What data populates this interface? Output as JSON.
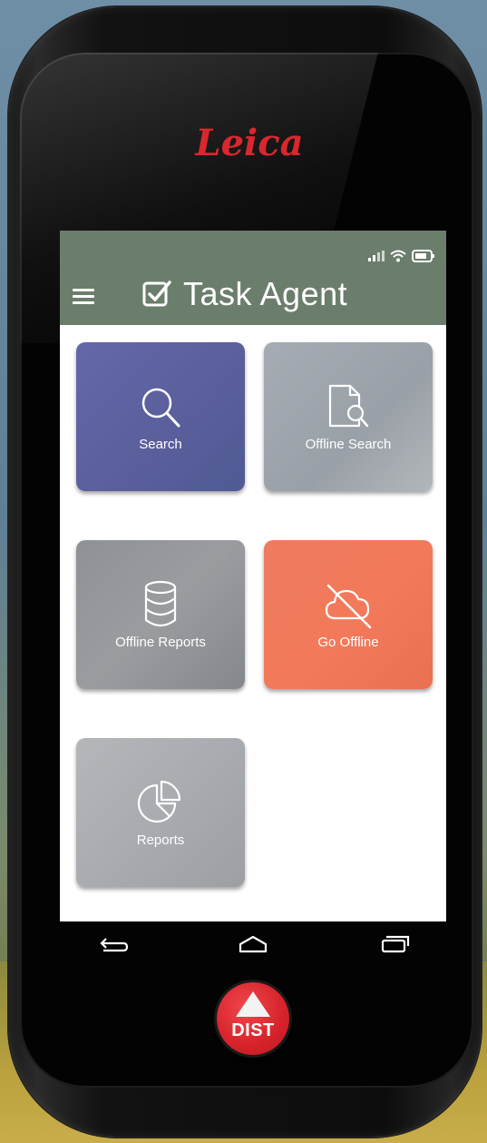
{
  "brand": {
    "logo_text": "Leica",
    "logo_color": "#d9272e"
  },
  "app": {
    "title": "Task Agent",
    "appbar_color": "#6b7e6c"
  },
  "tiles": [
    {
      "label": "Search",
      "icon": "search-icon",
      "color": "#5e63a2"
    },
    {
      "label": "Offline Search",
      "icon": "file-search-icon",
      "color": "#9fa5ab"
    },
    {
      "label": "Offline Reports",
      "icon": "database-icon",
      "color": "#909397"
    },
    {
      "label": "Go Offline",
      "icon": "cloud-off-icon",
      "color": "#f0775a"
    },
    {
      "label": "Reports",
      "icon": "pie-chart-icon",
      "color": "#aeb1b4"
    }
  ],
  "navigation": {
    "back_icon": "back-icon",
    "home_icon": "home-icon",
    "recents_icon": "recents-icon"
  },
  "hardware": {
    "dist_label": "DIST",
    "dist_color": "#d6222a"
  }
}
